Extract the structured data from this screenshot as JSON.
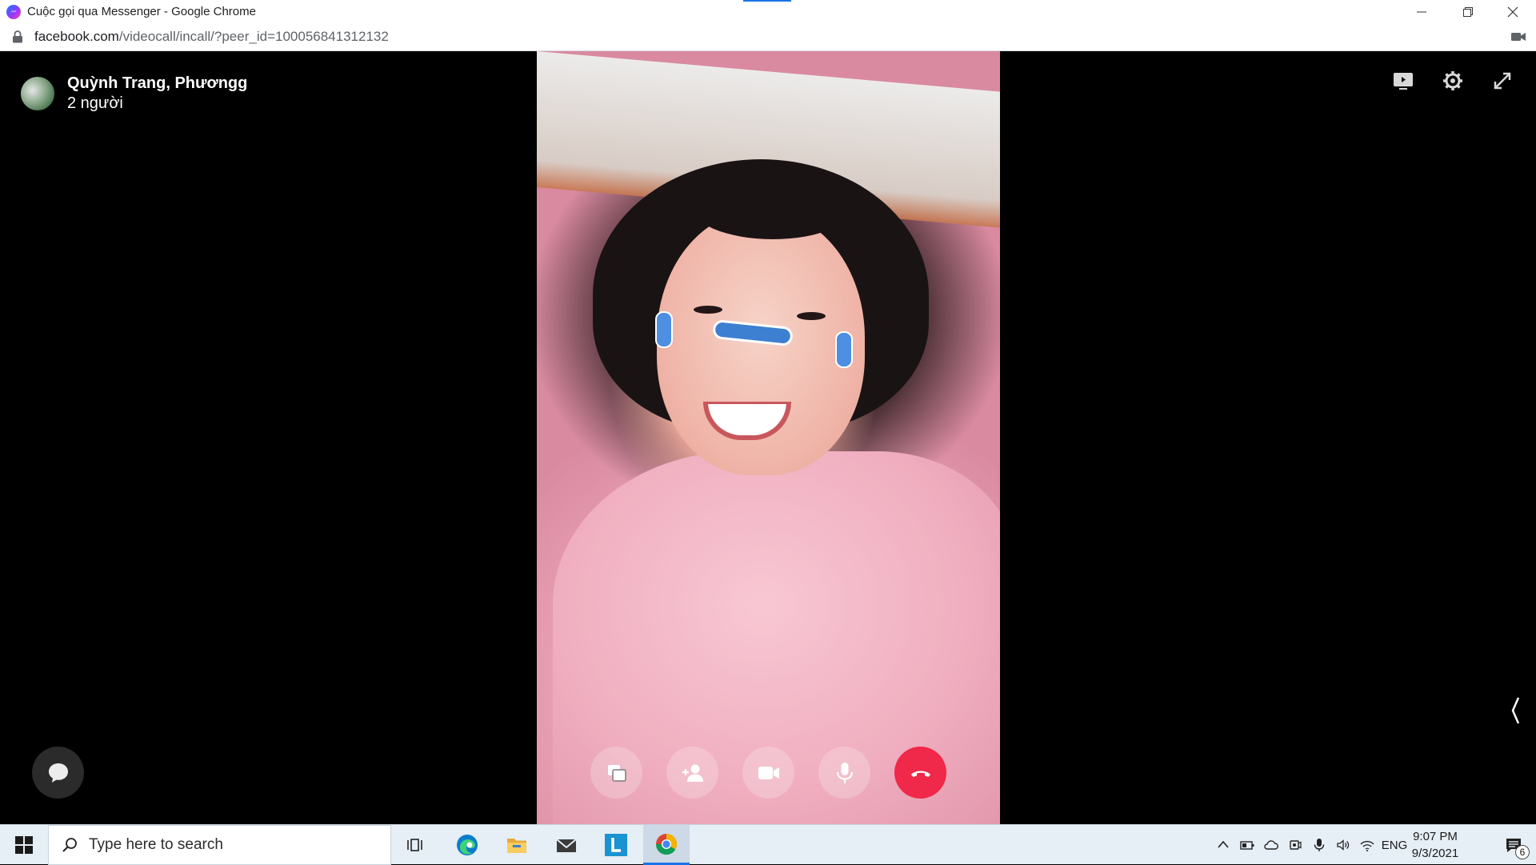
{
  "window": {
    "title": "Cuộc gọi qua Messenger - Google Chrome",
    "favicon": "messenger-icon"
  },
  "address": {
    "domain": "facebook.com",
    "path": "/videocall/incall/?peer_id=100056841312132"
  },
  "call": {
    "participants_name": "Quỳnh Trang, Phươngg",
    "participants_count": "2 người",
    "top_icons": [
      "screen-share-icon",
      "gear-icon",
      "expand-icon"
    ],
    "controls": [
      "share-screen-button",
      "add-person-button",
      "video-camera-button",
      "microphone-button",
      "end-call-button"
    ],
    "end_call_color": "#f02849"
  },
  "taskbar": {
    "search_placeholder": "Type here to search",
    "apps": [
      "task-view-icon",
      "edge-icon",
      "file-explorer-icon",
      "mail-icon",
      "l-app-icon",
      "chrome-icon"
    ],
    "language": "ENG",
    "time": "9:07 PM",
    "date": "9/3/2021",
    "notification_count": "6"
  }
}
